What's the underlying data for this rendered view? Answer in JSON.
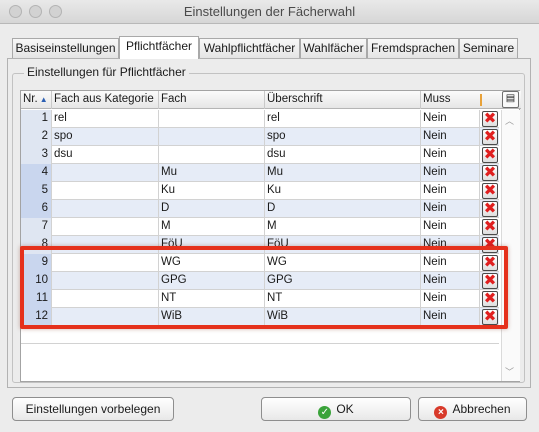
{
  "window": {
    "title": "Einstellungen der Fächerwahl"
  },
  "tabs": [
    {
      "label": "Basiseinstellungen",
      "active": false
    },
    {
      "label": "Pflichtfächer",
      "active": true
    },
    {
      "label": "Wahlpflichtfächer",
      "active": false
    },
    {
      "label": "Wahlfächer",
      "active": false
    },
    {
      "label": "Fremdsprachen",
      "active": false
    },
    {
      "label": "Seminare",
      "active": false
    }
  ],
  "group": {
    "title": "Einstellungen für Pflichtfächer"
  },
  "table": {
    "columns": {
      "nr": "Nr.",
      "kategorie": "Fach aus Kategorie",
      "fach": "Fach",
      "ueberschrift": "Überschrift",
      "muss": "Muss"
    },
    "column_menu_icon": "column-chooser-icon",
    "rows": [
      {
        "nr": "1",
        "kategorie": "rel",
        "fach": "",
        "ueberschrift": "rel",
        "muss": "Nein"
      },
      {
        "nr": "2",
        "kategorie": "spo",
        "fach": "",
        "ueberschrift": "spo",
        "muss": "Nein"
      },
      {
        "nr": "3",
        "kategorie": "dsu",
        "fach": "",
        "ueberschrift": "dsu",
        "muss": "Nein"
      },
      {
        "nr": "4",
        "kategorie": "",
        "fach": "Mu",
        "ueberschrift": "Mu",
        "muss": "Nein"
      },
      {
        "nr": "5",
        "kategorie": "",
        "fach": "Ku",
        "ueberschrift": "Ku",
        "muss": "Nein"
      },
      {
        "nr": "6",
        "kategorie": "",
        "fach": "D",
        "ueberschrift": "D",
        "muss": "Nein"
      },
      {
        "nr": "7",
        "kategorie": "",
        "fach": "M",
        "ueberschrift": "M",
        "muss": "Nein"
      },
      {
        "nr": "8",
        "kategorie": "",
        "fach": "FöU",
        "ueberschrift": "FöU",
        "muss": "Nein"
      },
      {
        "nr": "9",
        "kategorie": "",
        "fach": "WG",
        "ueberschrift": "WG",
        "muss": "Nein"
      },
      {
        "nr": "10",
        "kategorie": "",
        "fach": "GPG",
        "ueberschrift": "GPG",
        "muss": "Nein"
      },
      {
        "nr": "11",
        "kategorie": "",
        "fach": "NT",
        "ueberschrift": "NT",
        "muss": "Nein"
      },
      {
        "nr": "12",
        "kategorie": "",
        "fach": "WiB",
        "ueberschrift": "WiB",
        "muss": "Nein"
      }
    ],
    "delete_icon": "delete-x-icon"
  },
  "buttons": {
    "defaults": "Einstellungen vorbelegen",
    "ok": "OK",
    "cancel": "Abbrechen"
  },
  "colors": {
    "highlight": "#e5311c",
    "delete_x": "#e02020",
    "row_alt": "#e6ecf7"
  }
}
